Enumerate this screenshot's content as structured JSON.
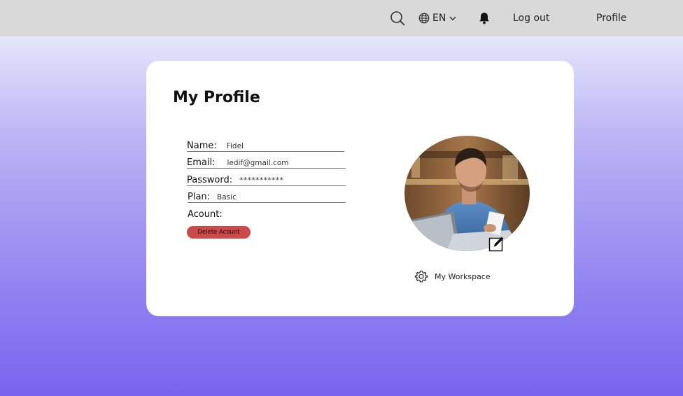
{
  "topbar": {
    "search_icon": "search-icon",
    "language": "EN",
    "globe_icon": "globe-icon",
    "bell_icon": "bell-icon",
    "logout_label": "Log out",
    "profile_label": "Profile"
  },
  "profile": {
    "title": "My Profile",
    "fields": {
      "name_label": "Name:",
      "name_value": "Fidel",
      "email_label": "Email:",
      "email_value": "ledif@gmail.com",
      "password_label": "Password:",
      "password_value": "***********",
      "plan_label": "Plan:",
      "plan_value": "Basic",
      "account_label": "Acount:"
    },
    "delete_label": "Delete Acount",
    "workspace_label": "My Workspace",
    "colors": {
      "delete_button": "#cc4a4a",
      "background_top": "#e6e6fb",
      "background_bottom": "#7a63ee"
    }
  }
}
